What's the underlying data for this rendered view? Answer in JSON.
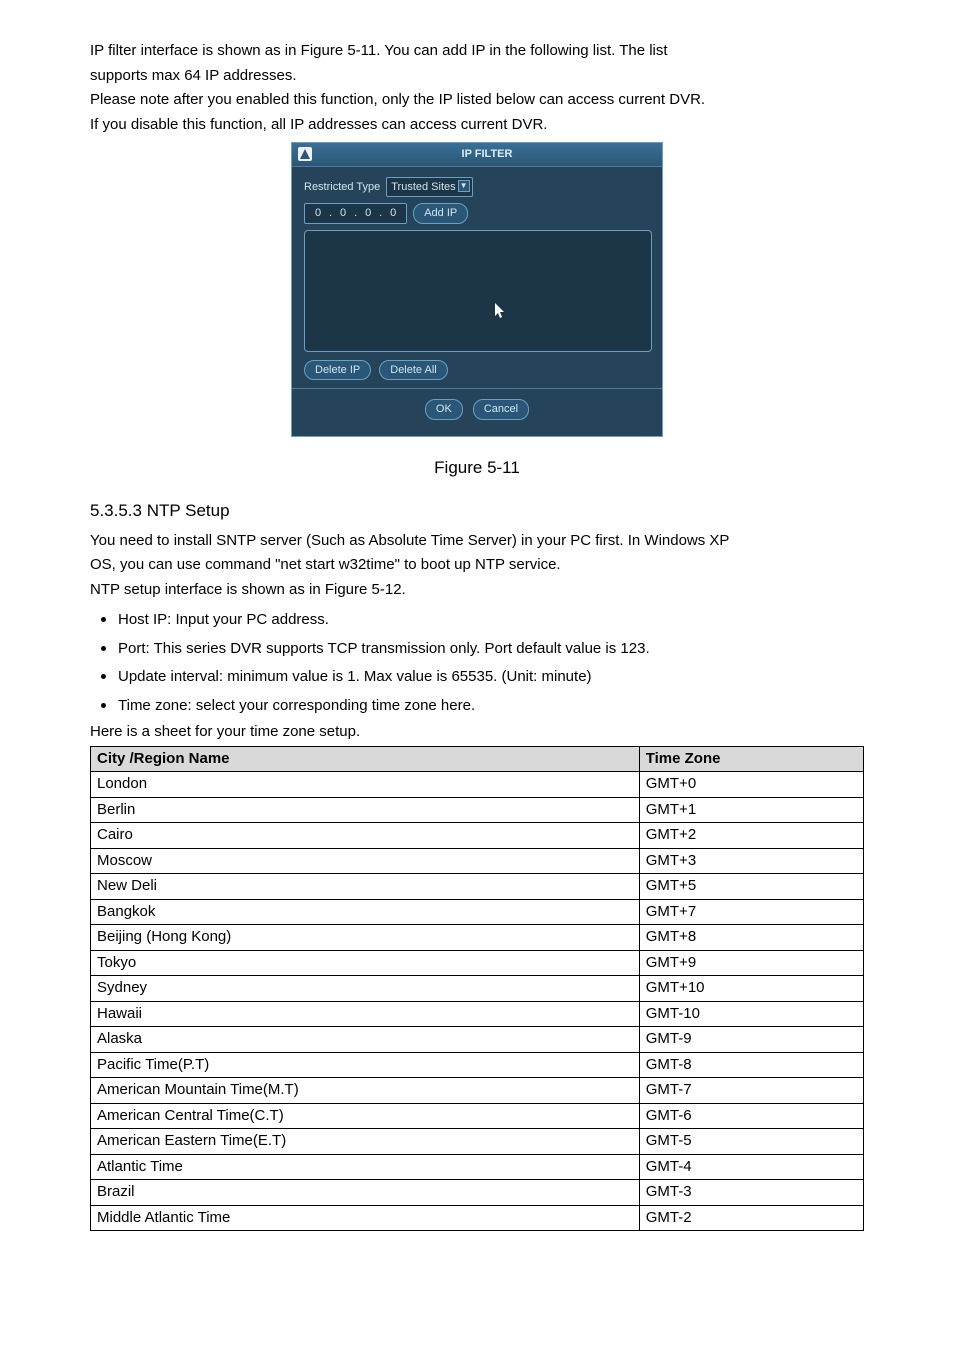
{
  "intro": {
    "p1a": "IP filter interface is shown as in Figure 5-11. You can add IP in the following list.  The list",
    "p1b": "supports max 64 IP addresses.",
    "p2": "Please note after you enabled this function, only the IP listed below can access current DVR.",
    "p3": "If you disable this function, all IP addresses can access current DVR."
  },
  "dialog": {
    "title": "IP FILTER",
    "restricted_label": "Restricted Type",
    "restricted_value": "Trusted Sites",
    "ip_octets": [
      "0",
      "0",
      "0",
      "0"
    ],
    "add_ip": "Add IP",
    "delete_ip": "Delete IP",
    "delete_all": "Delete All",
    "ok": "OK",
    "cancel": "Cancel"
  },
  "figure_caption": "Figure 5-11",
  "section": {
    "heading": "5.3.5.3  NTP Setup",
    "p1": "You need to install SNTP server (Such as Absolute Time Server) in your PC first. In Windows XP",
    "p2": "OS, you can use command \"net start w32time\" to boot up NTP service.",
    "p3": "NTP setup interface is shown as in Figure 5-12.",
    "bullets": [
      "Host IP: Input your PC address.",
      "Port:  This series DVR supports TCP transmission only. Port default value is 123.",
      "Update interval: minimum value is 1. Max value is 65535. (Unit: minute)",
      "Time zone: select your corresponding time zone here."
    ],
    "p4": "Here is a sheet for your time zone setup."
  },
  "table": {
    "headers": [
      "City /Region Name",
      "Time Zone"
    ],
    "rows": [
      [
        "London",
        "GMT+0"
      ],
      [
        "Berlin",
        "GMT+1"
      ],
      [
        "Cairo",
        "GMT+2"
      ],
      [
        "Moscow",
        "GMT+3"
      ],
      [
        "New Deli",
        "GMT+5"
      ],
      [
        "Bangkok",
        "GMT+7"
      ],
      [
        "Beijing (Hong Kong)",
        "GMT+8"
      ],
      [
        "Tokyo",
        "GMT+9"
      ],
      [
        "Sydney",
        "GMT+10"
      ],
      [
        "Hawaii",
        "GMT-10"
      ],
      [
        "Alaska",
        "GMT-9"
      ],
      [
        "Pacific Time(P.T)",
        "GMT-8"
      ],
      [
        "American  Mountain Time(M.T)",
        "GMT-7"
      ],
      [
        "American Central Time(C.T)",
        "GMT-6"
      ],
      [
        "American Eastern Time(E.T)",
        "GMT-5"
      ],
      [
        "Atlantic Time",
        "GMT-4"
      ],
      [
        "Brazil",
        "GMT-3"
      ],
      [
        "Middle Atlantic Time",
        "GMT-2"
      ]
    ]
  }
}
